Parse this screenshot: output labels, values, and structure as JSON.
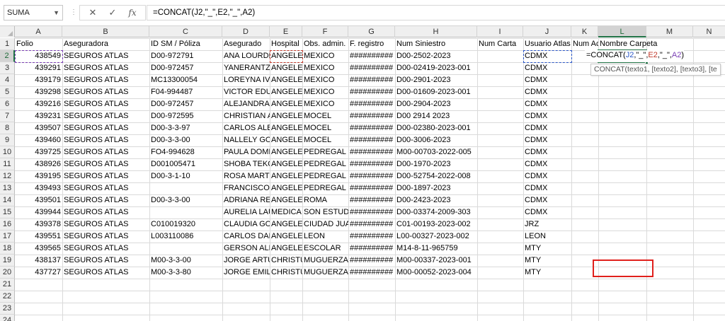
{
  "formula_bar": {
    "name_box": "SUMA",
    "cancel_icon": "✕",
    "enter_icon": "✓",
    "fx_label": "fx",
    "formula": "=CONCAT(J2,\"_\",E2,\"_\",A2)"
  },
  "columns": [
    "A",
    "B",
    "C",
    "D",
    "E",
    "F",
    "G",
    "H",
    "I",
    "J",
    "K",
    "L",
    "M",
    "N"
  ],
  "rows": [
    "1",
    "2",
    "3",
    "4",
    "5",
    "6",
    "7",
    "8",
    "9",
    "10",
    "11",
    "12",
    "13",
    "14",
    "15",
    "16",
    "17",
    "18",
    "19",
    "20",
    "21",
    "22",
    "23",
    "24"
  ],
  "headers": {
    "a": "Folio",
    "b": "Aseguradora",
    "c": "ID SM / Póliza",
    "d": "Asegurado",
    "e": "Hospital",
    "f": "Obs. admin.",
    "g": "F. registro",
    "h": "Num Siniestro",
    "i": "Num Carta",
    "j": "Usuario Atlas",
    "k": "Num Ac",
    "l": "Nombre Carpeta"
  },
  "table": [
    {
      "a": "438549",
      "b": "SEGUROS ATLAS",
      "c": "D00-972791",
      "d": "ANA LOURDES",
      "e": "ANGELES",
      "f": "MEXICO",
      "g": "##########",
      "h": "D00-2502-2023",
      "j": "CDMX"
    },
    {
      "a": "439291",
      "b": "SEGUROS ATLAS",
      "c": "D00-972457",
      "d": "YANERANTZI",
      "e": "ANGELES",
      "f": "MEXICO",
      "g": "##########",
      "h": "D00-02419-2023-001",
      "j": "CDMX"
    },
    {
      "a": "439179",
      "b": "SEGUROS ATLAS",
      "c": "MC13300054",
      "d": "LOREYNA IVE",
      "e": "ANGELES",
      "f": "MEXICO",
      "g": "##########",
      "h": "D00-2901-2023",
      "j": "CDMX"
    },
    {
      "a": "439298",
      "b": "SEGUROS ATLAS",
      "c": "F04-994487",
      "d": "VICTOR EDU",
      "e": "ANGELES",
      "f": "MEXICO",
      "g": "##########",
      "h": "D00-01609-2023-001",
      "j": "CDMX"
    },
    {
      "a": "439216",
      "b": "SEGUROS ATLAS",
      "c": "D00-972457",
      "d": "ALEJANDRA",
      "e": "ANGELES",
      "f": "MEXICO",
      "g": "##########",
      "h": "D00-2904-2023",
      "j": "CDMX"
    },
    {
      "a": "439231",
      "b": "SEGUROS ATLAS",
      "c": "D00-972595",
      "d": "CHRISTIAN A",
      "e": "ANGELES",
      "f": "MOCEL",
      "g": "##########",
      "h": "D00 2914 2023",
      "j": "CDMX"
    },
    {
      "a": "439507",
      "b": "SEGUROS ATLAS",
      "c": "D00-3-3-97",
      "d": "CARLOS ALB",
      "e": "ANGELES",
      "f": "MOCEL",
      "g": "##########",
      "h": "D00-02380-2023-001",
      "j": "CDMX"
    },
    {
      "a": "439460",
      "b": "SEGUROS ATLAS",
      "c": "D00-3-3-00",
      "d": "NALLELY GO",
      "e": "ANGELES",
      "f": "MOCEL",
      "g": "##########",
      "h": "D00-3006-2023",
      "j": "CDMX"
    },
    {
      "a": "439725",
      "b": "SEGUROS ATLAS",
      "c": "FO4-994628",
      "d": "PAULA DOMI",
      "e": "ANGELES",
      "f": "PEDREGAL",
      "g": "##########",
      "h": "M00-00703-2022-005",
      "j": "CDMX"
    },
    {
      "a": "438926",
      "b": "SEGUROS ATLAS",
      "c": "D001005471",
      "d": "SHOBA TEKC",
      "e": "ANGELES",
      "f": "PEDREGAL",
      "g": "##########",
      "h": "D00-1970-2023",
      "j": "CDMX"
    },
    {
      "a": "439195",
      "b": "SEGUROS ATLAS",
      "c": "D00-3-1-10",
      "d": "ROSA MARTI",
      "e": "ANGELES",
      "f": "PEDREGAL",
      "g": "##########",
      "h": "D00-52754-2022-008",
      "j": "CDMX"
    },
    {
      "a": "439493",
      "b": "SEGUROS ATLAS",
      "c": "",
      "d": "FRANCISCO S",
      "e": "ANGELES",
      "f": "PEDREGAL",
      "g": "##########",
      "h": "D00-1897-2023",
      "j": "CDMX"
    },
    {
      "a": "439501",
      "b": "SEGUROS ATLAS",
      "c": "D00-3-3-00",
      "d": "ADRIANA RE",
      "e": "ANGELES",
      "f": "ROMA",
      "g": "##########",
      "h": "D00-2423-2023",
      "j": "CDMX"
    },
    {
      "a": "439944",
      "b": "SEGUROS ATLAS",
      "c": "",
      "d": "AURELIA LAU",
      "e": "MEDICA",
      "f": "SON ESTUDIO",
      "g": "##########",
      "h": "D00-03374-2009-303",
      "j": "CDMX"
    },
    {
      "a": "439378",
      "b": "SEGUROS ATLAS",
      "c": "C010019320",
      "d": "CLAUDIA GO",
      "e": "ANGELES",
      "f": "CIUDAD JUA",
      "g": "##########",
      "h": "C01-00193-2023-002",
      "j": "JRZ"
    },
    {
      "a": "439551",
      "b": "SEGUROS ATLAS",
      "c": "L003110086",
      "d": "CARLOS DAN",
      "e": "ANGELES",
      "f": "LEON",
      "g": "##########",
      "h": "L00-00327-2023-002",
      "j": "LEON"
    },
    {
      "a": "439565",
      "b": "SEGUROS ATLAS",
      "c": "",
      "d": "GERSON ALE",
      "e": "ANGELES",
      "f": "ESCOLAR",
      "g": "##########",
      "h": "M14-8-11-965759",
      "j": "MTY"
    },
    {
      "a": "438137",
      "b": "SEGUROS ATLAS",
      "c": "M00-3-3-00",
      "d": "JORGE ARTU",
      "e": "CHRISTUS",
      "f": "MUGUERZA",
      "g": "##########",
      "h": "M00-00337-2023-001",
      "j": "MTY"
    },
    {
      "a": "437727",
      "b": "SEGUROS ATLAS",
      "c": "M00-3-3-80",
      "d": "JORGE EMILI",
      "e": "CHRISTUS",
      "f": "MUGUERZA",
      "g": "##########",
      "h": "M00-00052-2023-004",
      "j": "MTY"
    }
  ],
  "editor": {
    "p1": "=CONCAT(",
    "ref1": "J2",
    "p2": ",\"_\",",
    "ref2": "E2",
    "p3": ",\"_\",",
    "ref3": "A2",
    "p4": ")"
  },
  "tooltip": "CONCAT(texto1, [texto2], [texto3], [te",
  "colors": {
    "accent": "#217346",
    "ref_blue": "#2b57c7",
    "ref_red": "#c0392b",
    "ref_purple": "#7b3fb5",
    "highlight_box": "#e0201c"
  }
}
